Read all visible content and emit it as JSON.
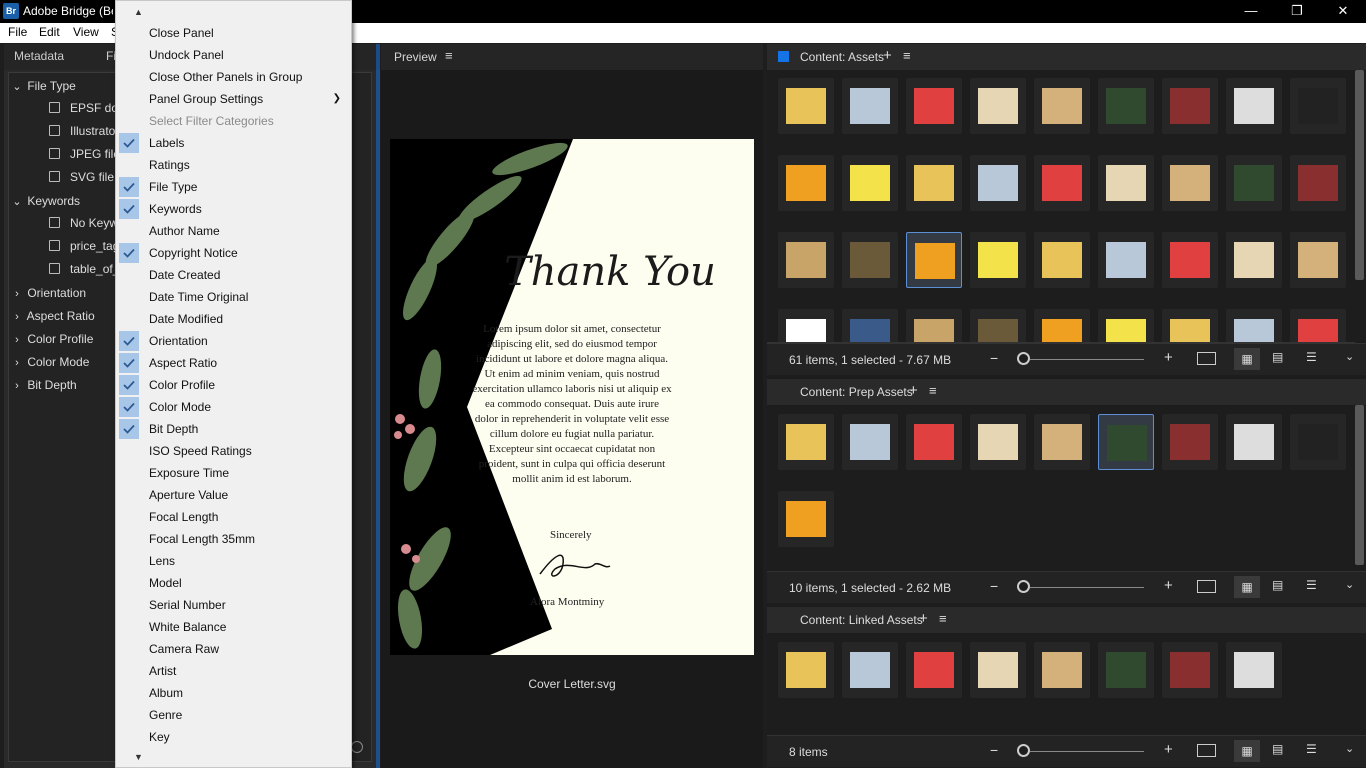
{
  "window": {
    "title": "Adobe Bridge (Be",
    "icon_text": "Br"
  },
  "menubar": [
    "File",
    "Edit",
    "View",
    "S"
  ],
  "left_tabs": [
    "Metadata",
    "Fi"
  ],
  "filters": {
    "file_type": {
      "label": "File Type",
      "items": [
        "EPSF doc",
        "Illustrato",
        "JPEG file",
        "SVG file"
      ]
    },
    "keywords": {
      "label": "Keywords",
      "items": [
        "No Keyw",
        "price_tag",
        "table_of_"
      ]
    },
    "collapsed": [
      "Orientation",
      "Aspect Ratio",
      "Color Profile",
      "Color Mode",
      "Bit Depth"
    ]
  },
  "context_menu": {
    "items": [
      {
        "label": "Close Panel",
        "checked": false
      },
      {
        "label": "Undock Panel",
        "checked": false
      },
      {
        "label": "Close Other Panels in Group",
        "checked": false
      },
      {
        "label": "Panel Group Settings",
        "checked": false,
        "submenu": true
      },
      {
        "label": "Select Filter Categories",
        "checked": false,
        "disabled": true
      },
      {
        "label": "Labels",
        "checked": true
      },
      {
        "label": "Ratings",
        "checked": false
      },
      {
        "label": "File Type",
        "checked": true
      },
      {
        "label": "Keywords",
        "checked": true
      },
      {
        "label": "Author Name",
        "checked": false
      },
      {
        "label": "Copyright Notice",
        "checked": true
      },
      {
        "label": "Date Created",
        "checked": false
      },
      {
        "label": "Date Time Original",
        "checked": false
      },
      {
        "label": "Date Modified",
        "checked": false
      },
      {
        "label": "Orientation",
        "checked": true
      },
      {
        "label": "Aspect Ratio",
        "checked": true
      },
      {
        "label": "Color Profile",
        "checked": true
      },
      {
        "label": "Color Mode",
        "checked": true
      },
      {
        "label": "Bit Depth",
        "checked": true
      },
      {
        "label": "ISO Speed Ratings",
        "checked": false
      },
      {
        "label": "Exposure Time",
        "checked": false
      },
      {
        "label": "Aperture Value",
        "checked": false
      },
      {
        "label": "Focal Length",
        "checked": false
      },
      {
        "label": "Focal Length 35mm",
        "checked": false
      },
      {
        "label": "Lens",
        "checked": false
      },
      {
        "label": "Model",
        "checked": false
      },
      {
        "label": "Serial Number",
        "checked": false
      },
      {
        "label": "White Balance",
        "checked": false
      },
      {
        "label": "Camera Raw",
        "checked": false
      },
      {
        "label": "Artist",
        "checked": false
      },
      {
        "label": "Album",
        "checked": false
      },
      {
        "label": "Genre",
        "checked": false
      },
      {
        "label": "Key",
        "checked": false
      }
    ]
  },
  "preview": {
    "title": "Preview",
    "filename": "Cover Letter.svg",
    "doc": {
      "heading": "Thank You",
      "body": "Lorem ipsum dolor sit amet, consectetur adipiscing elit, sed do eiusmod tempor incididunt ut labore et dolore magna aliqua. Ut enim ad minim veniam, quis nostrud exercitation ullamco laboris nisi ut aliquip ex ea commodo consequat. Duis aute irure dolor in reprehenderit in voluptate velit esse cillum dolore eu fugiat nulla pariatur. Excepteur sint occaecat cupidatat non proident, sunt in culpa qui officia deserunt mollit anim id est laborum.",
      "closing": "Sincerely",
      "name": "Alora Montminy"
    }
  },
  "content_panels": [
    {
      "title": "Content: Assets",
      "footer": "61 items, 1 selected - 7.67 MB"
    },
    {
      "title": "Content: Prep Assets",
      "footer": "10 items, 1 selected - 2.62 MB"
    },
    {
      "title": "Content: Linked Assets",
      "footer": "8 items"
    }
  ],
  "colors": {
    "accent": "#1473e6",
    "check_bg": "#a8c6e8",
    "selection": "#5d8fd6"
  }
}
